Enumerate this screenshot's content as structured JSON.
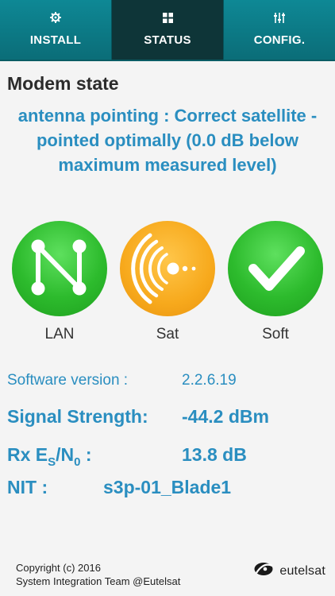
{
  "tabs": [
    {
      "label": "INSTALL",
      "icon": "gear-icon"
    },
    {
      "label": "STATUS",
      "icon": "grid-icon"
    },
    {
      "label": "CONFIG.",
      "icon": "sliders-icon"
    }
  ],
  "page_title": "Modem state",
  "state_message": "antenna pointing : Correct satellite - pointed optimally (0.0 dB below maximum measured level)",
  "status": [
    {
      "label": "LAN",
      "icon": "network-icon",
      "color": "#2dbb2d"
    },
    {
      "label": "Sat",
      "icon": "satellite-icon",
      "color": "#f7a91c"
    },
    {
      "label": "Soft",
      "icon": "checkmark-icon",
      "color": "#2dbb2d"
    }
  ],
  "info": {
    "software_version_label": "Software version :",
    "software_version_value": "2.2.6.19",
    "signal_strength_label": "Signal Strength:",
    "signal_strength_value": "-44.2 dBm",
    "rx_label_prefix": "Rx E",
    "rx_label_sub_s": "S",
    "rx_label_mid": "/N",
    "rx_label_sub_0": "0",
    "rx_label_suffix": " :",
    "rx_value": "13.8 dB",
    "nit_label": "NIT :",
    "nit_value": "s3p-01_Blade1"
  },
  "footer": {
    "copyright": "Copyright (c) 2016",
    "team": "System Integration Team @Eutelsat",
    "brand": "eutelsat"
  },
  "colors": {
    "accent_text": "#2a8ec0",
    "tab_bar": "#0d7a86",
    "tab_active": "#0e3538",
    "ok_green": "#2dbb2d",
    "warn_orange": "#f7a91c"
  }
}
